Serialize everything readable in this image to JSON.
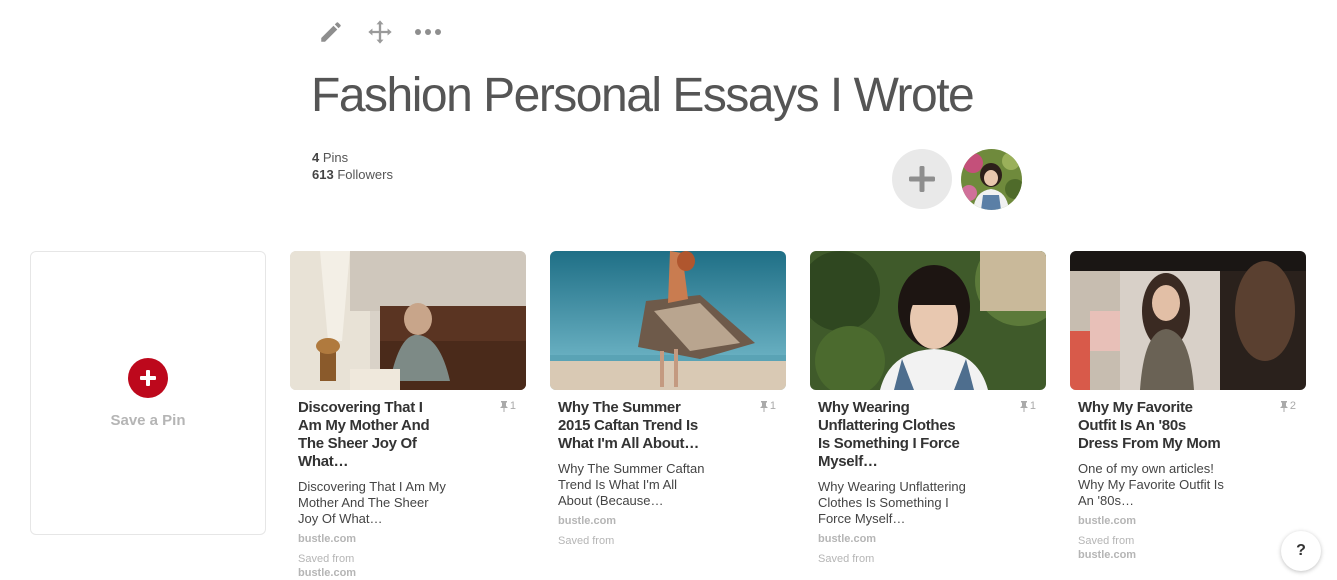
{
  "toolbar": {
    "edit_icon": "pencil-icon",
    "move_icon": "move-arrows-icon",
    "more_icon": "more-dots-icon"
  },
  "board": {
    "title": "Fashion Personal Essays I Wrote",
    "pins_count": "4",
    "pins_label": "Pins",
    "followers_count": "613",
    "followers_label": "Followers"
  },
  "save_card": {
    "label": "Save a Pin",
    "accent": "#bd081c"
  },
  "pins": [
    {
      "title": "Discovering That I Am My Mother And The Sheer Joy Of What…",
      "repins": "1",
      "description": "Discovering That I Am My Mother And The Sheer Joy Of What…",
      "domain": "bustle.com",
      "saved_from_label": "Saved from",
      "saved_from_domain": "bustle.com"
    },
    {
      "title": "Why The Summer 2015 Caftan Trend Is What I'm All About…",
      "repins": "1",
      "description": "Why The Summer Caftan Trend Is What I'm All About (Because…",
      "domain": "bustle.com",
      "saved_from_label": "Saved from",
      "saved_from_domain": ""
    },
    {
      "title": "Why Wearing Unflattering Clothes Is Something I Force Myself…",
      "repins": "1",
      "description": "Why Wearing Unflattering Clothes Is Something I Force Myself…",
      "domain": "bustle.com",
      "saved_from_label": "Saved from",
      "saved_from_domain": ""
    },
    {
      "title": "Why My Favorite Outfit Is An '80s Dress From My Mom",
      "repins": "2",
      "description": "One of my own articles! Why My Favorite Outfit Is An '80s…",
      "domain": "bustle.com",
      "saved_from_label": "Saved from",
      "saved_from_domain": "bustle.com"
    }
  ],
  "help": {
    "label": "?"
  }
}
